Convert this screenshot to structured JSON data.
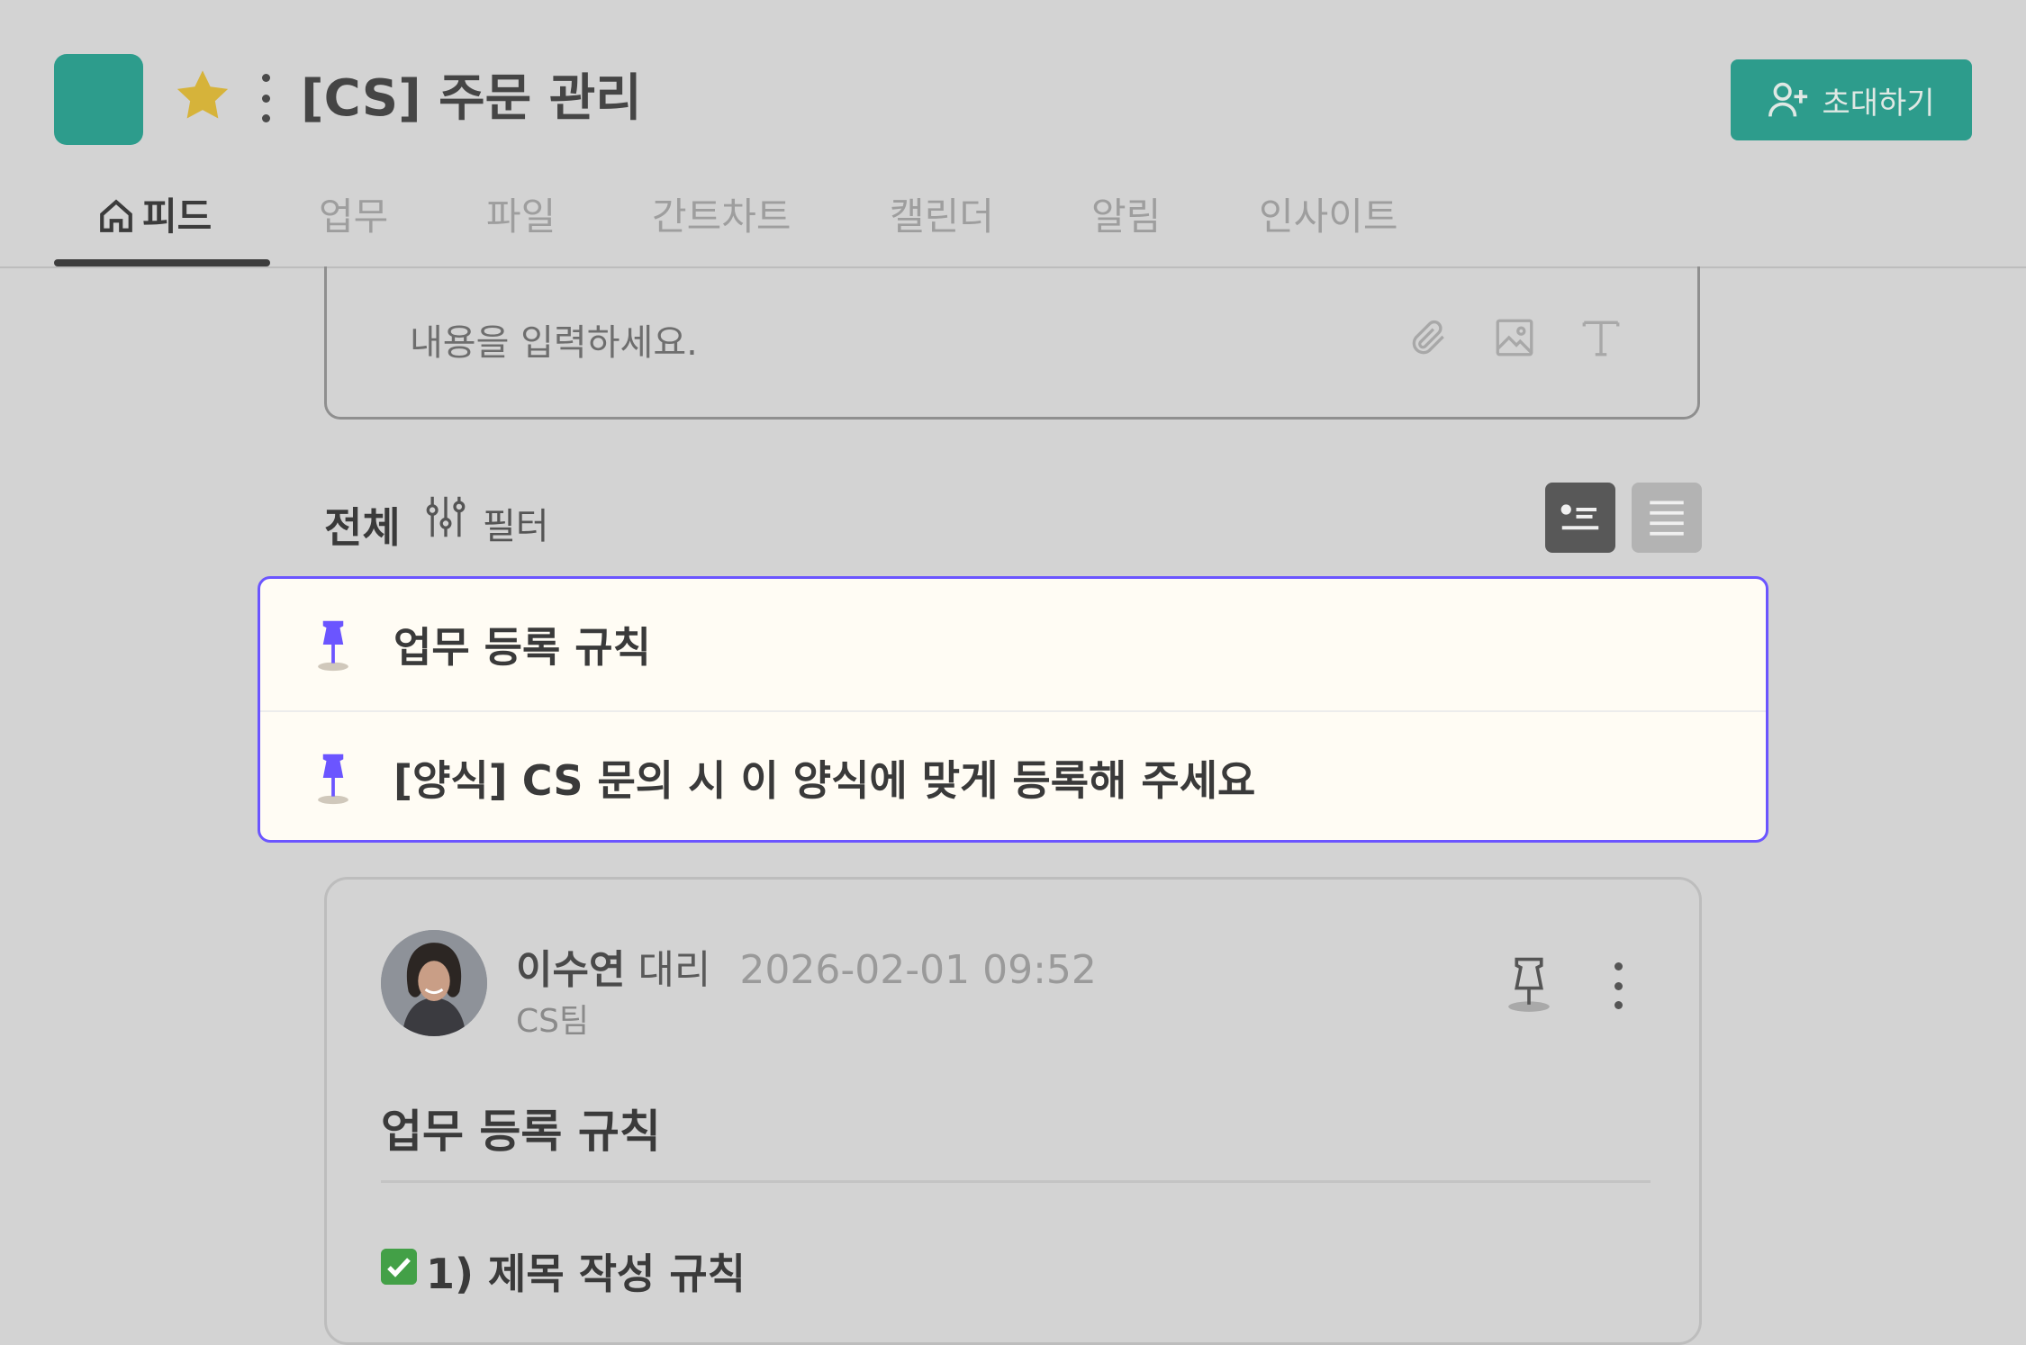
{
  "header": {
    "title": "[CS] 주문 관리",
    "invite_label": "초대하기",
    "logo_color": "#2d9c8c",
    "favorite": true
  },
  "tabs": [
    {
      "label": "피드",
      "active": true,
      "icon": "home-icon"
    },
    {
      "label": "업무",
      "active": false
    },
    {
      "label": "파일",
      "active": false
    },
    {
      "label": "간트차트",
      "active": false
    },
    {
      "label": "캘린더",
      "active": false
    },
    {
      "label": "알림",
      "active": false
    },
    {
      "label": "인사이트",
      "active": false
    }
  ],
  "editor": {
    "placeholder": "내용을 입력하세요.",
    "tools": [
      "paperclip-icon",
      "image-icon",
      "text-format-icon"
    ]
  },
  "feed_filter": {
    "all_label": "전체",
    "filter_label": "필터",
    "view_modes": [
      "card-view",
      "list-view"
    ],
    "active_view": "card-view"
  },
  "pinned": [
    {
      "title": "업무 등록 규칙"
    },
    {
      "title": "[양식] CS 문의 시 이 양식에 맞게 등록해 주세요"
    }
  ],
  "post": {
    "author_name": "이수연",
    "author_rank": "대리",
    "date": "2026-02-01 09:52",
    "team": "CS팀",
    "title": "업무 등록 규칙",
    "section_title": "1) 제목 작성 규칙"
  },
  "colors": {
    "accent": "#2d9c8c",
    "pin": "#6b55ff",
    "pinned_bg": "#fffcf4"
  }
}
